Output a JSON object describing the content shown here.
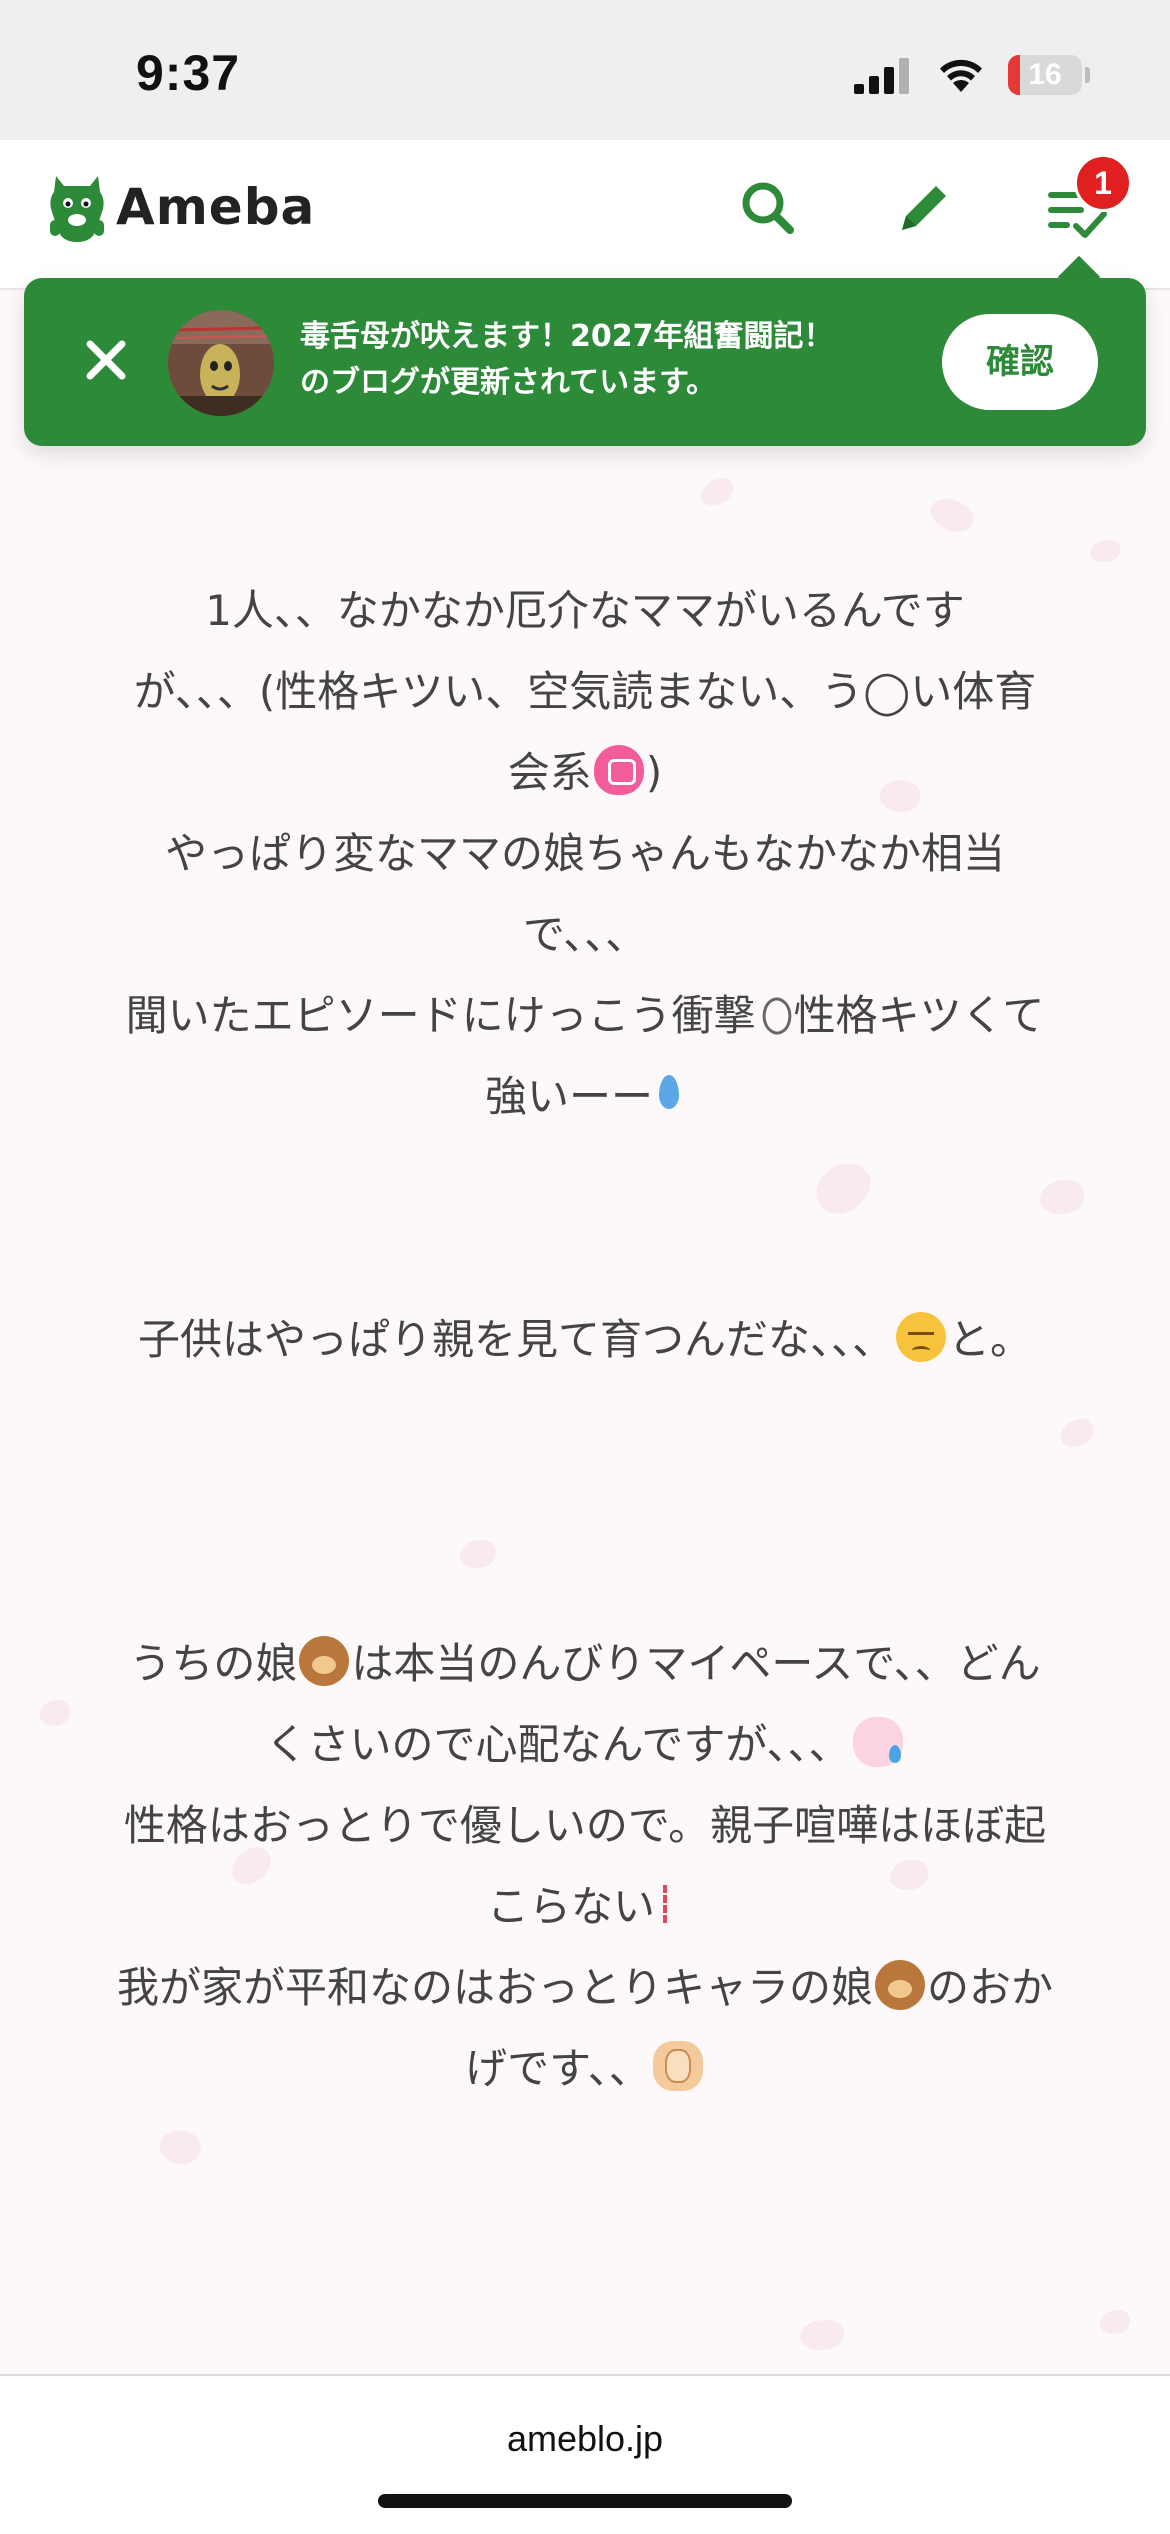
{
  "status_bar": {
    "time": "9:37",
    "battery_level": "16",
    "battery_fraction": 0.16
  },
  "header": {
    "logo_text": "Ameba",
    "brand_color": "#2d8a38",
    "notification_count": "1",
    "icons": [
      "search-icon",
      "pencil-icon",
      "feed-check-icon"
    ]
  },
  "toast": {
    "message_line1": "毒舌母が吠えます！2027年組奮闘記！",
    "message_line2": "のブログが更新されています。",
    "confirm_label": "確認",
    "close_icon": "close-icon"
  },
  "article": {
    "lines": [
      "1人、、なかなか厄介なママがいるんです",
      "が、、、(性格キツい、空気読まない、う◯い体育",
      "会系",
      ")",
      "やっぱり変なママの娘ちゃんもなかなか相当",
      "で、、、",
      "聞いたエピソードにけっこう衝撃",
      "性格キツくて",
      "強いーー",
      "子供はやっぱり親を見て育つんだな、、、",
      "と。",
      "うちの娘",
      "は本当のんびりマイペースで、、どん",
      "くさいので心配なんですが、、、",
      "性格はおっとりで優しいので。親子喧嘩はほぼ起",
      "こらない",
      "我が家が平和なのはおっとりキャラの娘",
      "のおか",
      "げです、、"
    ]
  },
  "footer": {
    "url": "ameblo.jp"
  }
}
